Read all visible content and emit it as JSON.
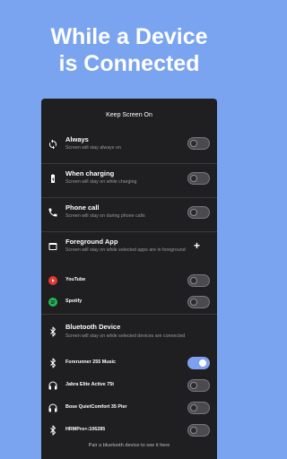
{
  "headline": {
    "line1": "While a Device",
    "line2": "is Connected"
  },
  "screen": {
    "title": "Keep Screen On"
  },
  "options": {
    "always": {
      "title": "Always",
      "subtitle": "Screen will stay always on",
      "enabled": false
    },
    "charging": {
      "title": "When charging",
      "subtitle": "Screen will stay on while charging",
      "enabled": false
    },
    "phone_call": {
      "title": "Phone call",
      "subtitle": "Screen will stay on during phone calls",
      "enabled": false
    },
    "foreground": {
      "title": "Foreground App",
      "subtitle": "Screen will stay on while selected apps are in foreground",
      "add_label": "+"
    }
  },
  "apps": [
    {
      "name": "YouTube",
      "enabled": false,
      "color": "#e53935"
    },
    {
      "name": "Spotify",
      "enabled": false,
      "color": "#1db954"
    }
  ],
  "bluetooth": {
    "title": "Bluetooth Device",
    "subtitle": "Screen will stay on while selected devices are connected",
    "devices": [
      {
        "name": "Forerunner 255 Music",
        "enabled": true,
        "icon": "bluetooth-icon"
      },
      {
        "name": "Jabra Elite Active 75t",
        "enabled": false,
        "icon": "headphones-icon"
      },
      {
        "name": "Bose QuietComfort 35 Pier",
        "enabled": false,
        "icon": "headphones-icon"
      },
      {
        "name": "HRMPro+:106285",
        "enabled": false,
        "icon": "bluetooth-icon"
      }
    ],
    "pair_hint": "Pair a bluetooth device to see it here"
  },
  "colors": {
    "background": "#7aa4f0",
    "panel": "#1f1f21",
    "accent": "#7ea1ef"
  }
}
